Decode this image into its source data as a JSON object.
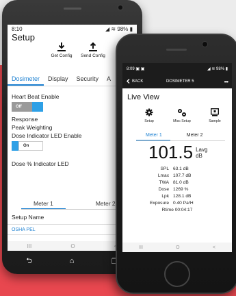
{
  "android": {
    "status": {
      "time": "8:10",
      "indicators": "98%"
    },
    "title": "Setup",
    "actions": [
      {
        "label": "Get Config",
        "icon": "download-icon"
      },
      {
        "label": "Send Config",
        "icon": "upload-icon"
      }
    ],
    "tabs": [
      "Dosimeter",
      "Display",
      "Security",
      "A"
    ],
    "active_tab": "Dosimeter",
    "fields": {
      "heartbeat_label": "Heart Beat Enable",
      "heartbeat_toggle": "Off",
      "response_label": "Response",
      "response_link": "S",
      "peak_label": "Peak Weighting",
      "led_label": "Dose Indicator LED Enable",
      "led_toggle": "On",
      "dose_led_label": "Dose % Indicator LED"
    },
    "meter_tabs": [
      "Meter 1",
      "Meter 2"
    ],
    "setup_name_label": "Setup Name",
    "setup_name_value": "OSHA PEL",
    "nav": {
      "recents": "III",
      "home": "O",
      "back": "<"
    },
    "hw_nav": {
      "back": "⮌",
      "home": "⌂",
      "recents": "❐"
    }
  },
  "iphone": {
    "status": {
      "time": "8:09",
      "indicators": "98%"
    },
    "appbar": {
      "back": "BACK",
      "title": "DOSIMETER 5",
      "more": "•••"
    },
    "live_view": "Live View",
    "actions": [
      {
        "label": "Setup",
        "icon": "gear-icon"
      },
      {
        "label": "Misc Setup",
        "icon": "gears-icon"
      },
      {
        "label": "Sample",
        "icon": "sample-icon"
      }
    ],
    "tabs": [
      "Meter 1",
      "Meter 2"
    ],
    "active_tab": "Meter 1",
    "main_value": "101.5",
    "main_unit_top": "Lavg",
    "main_unit_bottom": "dB",
    "readings": [
      {
        "label": "SPL",
        "value": "63.1 dB"
      },
      {
        "label": "Lmax",
        "value": "107.7 dB"
      },
      {
        "label": "TWA",
        "value": "81.0 dB"
      },
      {
        "label": "Dose",
        "value": "1269 %"
      },
      {
        "label": "Lpk",
        "value": "128.1 dB"
      },
      {
        "label": "Exposure",
        "value": "0.40 Pa²H"
      }
    ],
    "rtime": "Rtime 00:04:17",
    "nav": {
      "recents": "III",
      "home": "O",
      "back": "<"
    }
  },
  "colors": {
    "accent_blue": "#1a7fd1",
    "toggle_blue": "#2ea0e6",
    "background_red": "#e8474f",
    "status_bar_dark": "#1c1c1c"
  }
}
